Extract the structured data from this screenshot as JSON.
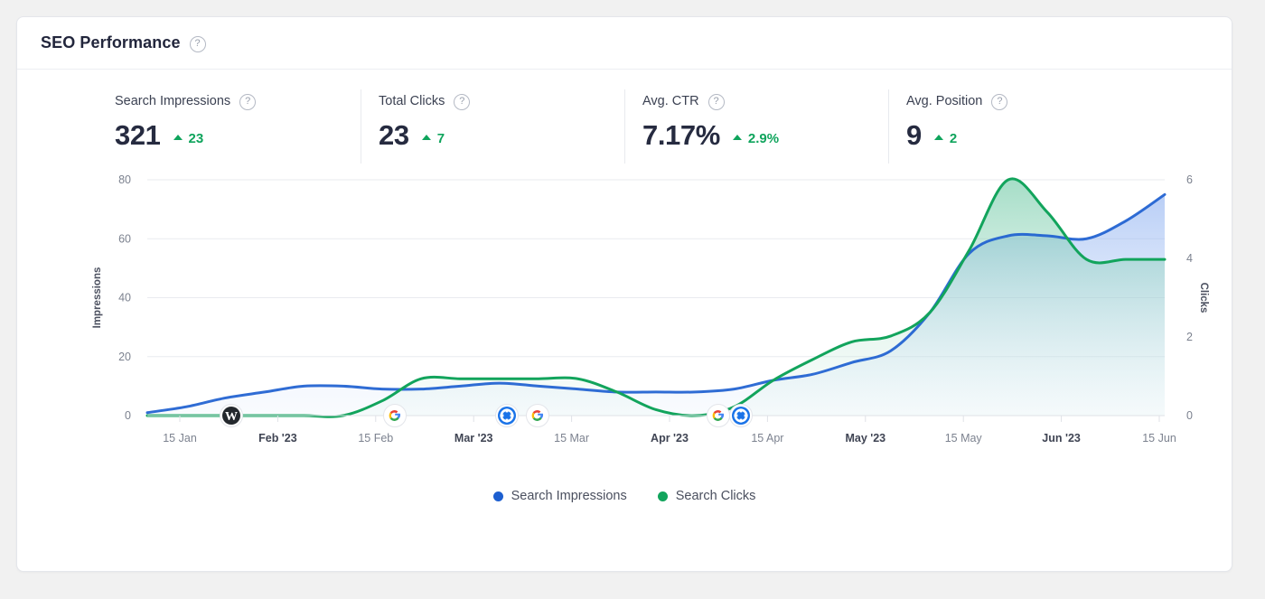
{
  "header": {
    "title": "SEO Performance",
    "help_icon": "question-circle-icon"
  },
  "metrics": [
    {
      "label": "Search Impressions",
      "value": "321",
      "delta": "23",
      "delta_direction": "up",
      "help_icon": "question-circle-icon"
    },
    {
      "label": "Total Clicks",
      "value": "23",
      "delta": "7",
      "delta_direction": "up",
      "help_icon": "question-circle-icon"
    },
    {
      "label": "Avg. CTR",
      "value": "7.17%",
      "delta": "2.9%",
      "delta_direction": "up",
      "help_icon": "question-circle-icon"
    },
    {
      "label": "Avg. Position",
      "value": "9",
      "delta": "2",
      "delta_direction": "up",
      "help_icon": "question-circle-icon"
    }
  ],
  "colors": {
    "impressions_line": "#1d5fd0",
    "clicks_line": "#12a45c",
    "delta_positive": "#0fa45c",
    "title": "#22263c",
    "grid": "#e9ebef"
  },
  "legend": [
    {
      "label": "Search Impressions",
      "color": "#1d5fd0"
    },
    {
      "label": "Search Clicks",
      "color": "#12a45c"
    }
  ],
  "annotations": [
    {
      "icon": "wordpress-icon",
      "x_label": "22 Jan"
    },
    {
      "icon": "google-icon",
      "x_label": "19 Feb"
    },
    {
      "icon": "search-console-icon",
      "x_label": "10 Mar"
    },
    {
      "icon": "google-icon",
      "x_label": "14 Mar"
    },
    {
      "icon": "google-icon",
      "x_label": "21 Apr"
    },
    {
      "icon": "search-console-icon",
      "x_label": "24 Apr"
    }
  ],
  "chart_data": {
    "type": "area",
    "title": "",
    "xlabel": "",
    "ylabel": "Impressions",
    "y2label": "Clicks",
    "grid": true,
    "legend_position": "bottom",
    "ylim": [
      0,
      80
    ],
    "y2lim": [
      0,
      6
    ],
    "yticks": [
      0,
      20,
      40,
      60,
      80
    ],
    "y2ticks": [
      0,
      2,
      4,
      6
    ],
    "tick_labels": [
      "15 Jan",
      "Feb '23",
      "15 Feb",
      "Mar '23",
      "15 Mar",
      "Apr '23",
      "15 Apr",
      "May '23",
      "15 May",
      "Jun '23",
      "15 Jun"
    ],
    "tick_label_bold": [
      false,
      true,
      false,
      true,
      false,
      true,
      false,
      true,
      false,
      true,
      false
    ],
    "x": [
      "1 Jan",
      "8 Jan",
      "15 Jan",
      "22 Jan",
      "29 Jan",
      "Feb '23",
      "8 Feb",
      "15 Feb",
      "22 Feb",
      "Mar '23",
      "8 Mar",
      "15 Mar",
      "22 Mar",
      "29 Mar",
      "Apr '23",
      "8 Apr",
      "15 Apr",
      "22 Apr",
      "29 Apr",
      "May '23",
      "8 May",
      "15 May",
      "22 May",
      "29 May",
      "Jun '23",
      "8 Jun",
      "15 Jun"
    ],
    "series": [
      {
        "name": "Search Impressions",
        "axis": "left",
        "color": "#1d5fd0",
        "unit": "impressions",
        "values": [
          1,
          3,
          6,
          8,
          10,
          10,
          9,
          9,
          10,
          11,
          10,
          9,
          8,
          8,
          8,
          9,
          12,
          14,
          18,
          22,
          35,
          55,
          61,
          61,
          60,
          66,
          75
        ]
      },
      {
        "name": "Search Clicks",
        "axis": "right",
        "color": "#12a45c",
        "unit": "clicks",
        "values_clicks": [
          0,
          0,
          0,
          0,
          0,
          0,
          0.4,
          0.95,
          0.95,
          0.95,
          0.95,
          0.95,
          0.6,
          0.15,
          0,
          0.25,
          0.9,
          1.4,
          1.9,
          2.0,
          2.6,
          4.2,
          6.0,
          5.2,
          4.0,
          4.0,
          4.0
        ],
        "values_scaled": [
          0,
          0,
          0,
          0,
          0,
          0,
          5,
          12.5,
          12.5,
          12.5,
          12.5,
          12.5,
          8,
          2,
          0,
          3,
          12,
          19,
          25,
          27,
          35,
          56,
          80,
          69,
          53,
          53,
          53
        ]
      }
    ]
  }
}
